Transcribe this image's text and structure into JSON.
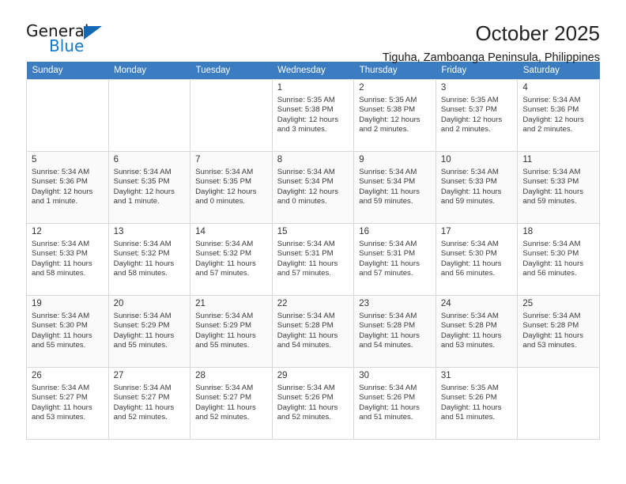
{
  "brand": {
    "name_top": "General",
    "name_bottom": "Blue",
    "accent_color": "#1579c6"
  },
  "header": {
    "title": "October 2025",
    "subtitle": "Tiguha, Zamboanga Peninsula, Philippines"
  },
  "theme": {
    "header_row_bg": "#3c7cc0",
    "header_row_text": "#ffffff",
    "cell_border": "#d8d8d8",
    "shaded_row_bg": "#fafafa"
  },
  "calendar": {
    "weekday_headers": [
      "Sunday",
      "Monday",
      "Tuesday",
      "Wednesday",
      "Thursday",
      "Friday",
      "Saturday"
    ],
    "labels": {
      "sunrise": "Sunrise:",
      "sunset": "Sunset:",
      "daylight": "Daylight:"
    },
    "weeks": [
      [
        {
          "day": "",
          "detail": ""
        },
        {
          "day": "",
          "detail": ""
        },
        {
          "day": "",
          "detail": ""
        },
        {
          "day": "1",
          "detail": "Sunrise: 5:35 AM\nSunset: 5:38 PM\nDaylight: 12 hours and 3 minutes."
        },
        {
          "day": "2",
          "detail": "Sunrise: 5:35 AM\nSunset: 5:38 PM\nDaylight: 12 hours and 2 minutes."
        },
        {
          "day": "3",
          "detail": "Sunrise: 5:35 AM\nSunset: 5:37 PM\nDaylight: 12 hours and 2 minutes."
        },
        {
          "day": "4",
          "detail": "Sunrise: 5:34 AM\nSunset: 5:36 PM\nDaylight: 12 hours and 2 minutes."
        }
      ],
      [
        {
          "day": "5",
          "detail": "Sunrise: 5:34 AM\nSunset: 5:36 PM\nDaylight: 12 hours and 1 minute."
        },
        {
          "day": "6",
          "detail": "Sunrise: 5:34 AM\nSunset: 5:35 PM\nDaylight: 12 hours and 1 minute."
        },
        {
          "day": "7",
          "detail": "Sunrise: 5:34 AM\nSunset: 5:35 PM\nDaylight: 12 hours and 0 minutes."
        },
        {
          "day": "8",
          "detail": "Sunrise: 5:34 AM\nSunset: 5:34 PM\nDaylight: 12 hours and 0 minutes."
        },
        {
          "day": "9",
          "detail": "Sunrise: 5:34 AM\nSunset: 5:34 PM\nDaylight: 11 hours and 59 minutes."
        },
        {
          "day": "10",
          "detail": "Sunrise: 5:34 AM\nSunset: 5:33 PM\nDaylight: 11 hours and 59 minutes."
        },
        {
          "day": "11",
          "detail": "Sunrise: 5:34 AM\nSunset: 5:33 PM\nDaylight: 11 hours and 59 minutes."
        }
      ],
      [
        {
          "day": "12",
          "detail": "Sunrise: 5:34 AM\nSunset: 5:33 PM\nDaylight: 11 hours and 58 minutes."
        },
        {
          "day": "13",
          "detail": "Sunrise: 5:34 AM\nSunset: 5:32 PM\nDaylight: 11 hours and 58 minutes."
        },
        {
          "day": "14",
          "detail": "Sunrise: 5:34 AM\nSunset: 5:32 PM\nDaylight: 11 hours and 57 minutes."
        },
        {
          "day": "15",
          "detail": "Sunrise: 5:34 AM\nSunset: 5:31 PM\nDaylight: 11 hours and 57 minutes."
        },
        {
          "day": "16",
          "detail": "Sunrise: 5:34 AM\nSunset: 5:31 PM\nDaylight: 11 hours and 57 minutes."
        },
        {
          "day": "17",
          "detail": "Sunrise: 5:34 AM\nSunset: 5:30 PM\nDaylight: 11 hours and 56 minutes."
        },
        {
          "day": "18",
          "detail": "Sunrise: 5:34 AM\nSunset: 5:30 PM\nDaylight: 11 hours and 56 minutes."
        }
      ],
      [
        {
          "day": "19",
          "detail": "Sunrise: 5:34 AM\nSunset: 5:30 PM\nDaylight: 11 hours and 55 minutes."
        },
        {
          "day": "20",
          "detail": "Sunrise: 5:34 AM\nSunset: 5:29 PM\nDaylight: 11 hours and 55 minutes."
        },
        {
          "day": "21",
          "detail": "Sunrise: 5:34 AM\nSunset: 5:29 PM\nDaylight: 11 hours and 55 minutes."
        },
        {
          "day": "22",
          "detail": "Sunrise: 5:34 AM\nSunset: 5:28 PM\nDaylight: 11 hours and 54 minutes."
        },
        {
          "day": "23",
          "detail": "Sunrise: 5:34 AM\nSunset: 5:28 PM\nDaylight: 11 hours and 54 minutes."
        },
        {
          "day": "24",
          "detail": "Sunrise: 5:34 AM\nSunset: 5:28 PM\nDaylight: 11 hours and 53 minutes."
        },
        {
          "day": "25",
          "detail": "Sunrise: 5:34 AM\nSunset: 5:28 PM\nDaylight: 11 hours and 53 minutes."
        }
      ],
      [
        {
          "day": "26",
          "detail": "Sunrise: 5:34 AM\nSunset: 5:27 PM\nDaylight: 11 hours and 53 minutes."
        },
        {
          "day": "27",
          "detail": "Sunrise: 5:34 AM\nSunset: 5:27 PM\nDaylight: 11 hours and 52 minutes."
        },
        {
          "day": "28",
          "detail": "Sunrise: 5:34 AM\nSunset: 5:27 PM\nDaylight: 11 hours and 52 minutes."
        },
        {
          "day": "29",
          "detail": "Sunrise: 5:34 AM\nSunset: 5:26 PM\nDaylight: 11 hours and 52 minutes."
        },
        {
          "day": "30",
          "detail": "Sunrise: 5:34 AM\nSunset: 5:26 PM\nDaylight: 11 hours and 51 minutes."
        },
        {
          "day": "31",
          "detail": "Sunrise: 5:35 AM\nSunset: 5:26 PM\nDaylight: 11 hours and 51 minutes."
        },
        {
          "day": "",
          "detail": ""
        }
      ]
    ]
  }
}
